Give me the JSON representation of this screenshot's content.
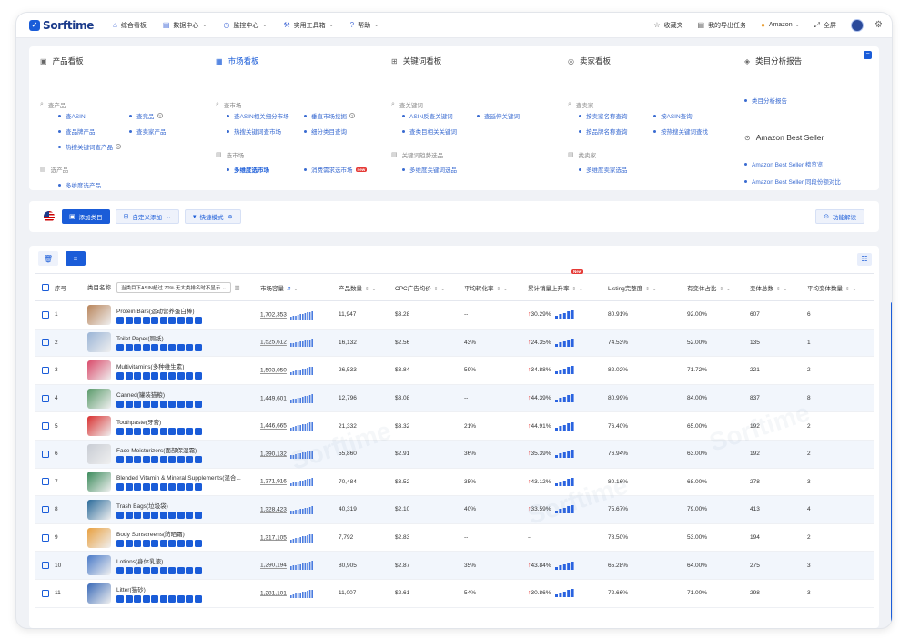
{
  "topbar": {
    "logo": "Sorftime",
    "nav": [
      {
        "icon": "home-icon",
        "label": "综合看板",
        "dropdown": false
      },
      {
        "icon": "database-icon",
        "label": "数据中心",
        "dropdown": true
      },
      {
        "icon": "monitor-icon",
        "label": "监控中心",
        "dropdown": true
      },
      {
        "icon": "toolbox-icon",
        "label": "实用工具箱",
        "dropdown": true
      },
      {
        "icon": "help-icon",
        "label": "帮助",
        "dropdown": true
      }
    ],
    "right": {
      "favorites": "收藏夹",
      "export_tasks": "我的导出任务",
      "marketplace": "Amazon",
      "fullscreen": "全屏"
    }
  },
  "menu": {
    "product": {
      "title": "产品看板",
      "sec1": "查产品",
      "links1": [
        "查ASIN",
        "查竞品",
        "查品牌产品",
        "查卖家产品",
        "热搜关键词查产品"
      ],
      "sec2": "选产品",
      "links2": [
        "多维度选产品"
      ]
    },
    "market": {
      "title": "市场看板",
      "sec1": "查市场",
      "links1": [
        "查ASIN相关细分市场",
        "垂直市场挖掘",
        "热搜关键词查市场",
        "细分类目查询"
      ],
      "sec2": "选市场",
      "links2": [
        "多维度选市场",
        "消费需求选市场"
      ],
      "new_label": "new"
    },
    "keyword": {
      "title": "关键词看板",
      "sec1": "查关键词",
      "links1": [
        "ASIN反查关键词",
        "查延伸关键词",
        "查类目相关关键词"
      ],
      "sec2": "关键词趋势选品",
      "links2": [
        "多维度关键词选品"
      ]
    },
    "seller": {
      "title": "卖家看板",
      "sec1": "查卖家",
      "links1": [
        "按卖家名称查询",
        "按ASIN查询",
        "按品牌名称查询",
        "按热搜关键词查找"
      ],
      "sec2": "找卖家",
      "links2": [
        "多维度卖家选品"
      ]
    },
    "category": {
      "title": "类目分析报告",
      "links1": [
        "类目分析报告"
      ],
      "title2": "Amazon Best Seller",
      "links2": [
        "Amazon Best Seller 榜览览",
        "Amazon Best Seller 同段份额对比"
      ]
    }
  },
  "toolbar": {
    "add_category": "添加类目",
    "custom_add": "自定义添加",
    "quick_mode": "快捷模式",
    "explain": "功能解读"
  },
  "table": {
    "filter_label": "当类目下ASIN超过 70% 无大类排名时不显示",
    "headers": {
      "checkbox": "",
      "index": "序号",
      "name": "类目名称",
      "market_cap": "市场容量",
      "product_count": "产品数量",
      "cpc": "CPC广告均价",
      "conversion": "平均转化率",
      "sales_rise": "累计销量上升率",
      "listing": "Listing完整度",
      "variant_ratio": "有变体占比",
      "variant_total": "变体总数",
      "avg_variant": "平均变体数量"
    },
    "new_tag": "New",
    "rows": [
      {
        "idx": "1",
        "name": "Protein Bars(运动营养蛋白棒)",
        "color": "#b8845a",
        "mc": "1,702,353",
        "pc": "11,947",
        "cpc": "$3.28",
        "conv": "--",
        "rise": "30.29%",
        "list": "80.91%",
        "vr": "92.00%",
        "vt": "607",
        "av": "6"
      },
      {
        "idx": "2",
        "name": "Toilet Paper(厕纸)",
        "color": "#9ab4d6",
        "mc": "1,525,612",
        "pc": "16,132",
        "cpc": "$2.56",
        "conv": "43%",
        "rise": "24.35%",
        "list": "74.53%",
        "vr": "52.00%",
        "vt": "135",
        "av": "1"
      },
      {
        "idx": "3",
        "name": "Multivitamins(多种维生素)",
        "color": "#d94a6a",
        "mc": "1,503,050",
        "pc": "26,533",
        "cpc": "$3.84",
        "conv": "59%",
        "rise": "34.88%",
        "list": "82.02%",
        "vr": "71.72%",
        "vt": "221",
        "av": "2"
      },
      {
        "idx": "4",
        "name": "Canned(罐装猫粮)",
        "color": "#5a9a6a",
        "mc": "1,449,601",
        "pc": "12,796",
        "cpc": "$3.08",
        "conv": "--",
        "rise": "44.39%",
        "list": "80.99%",
        "vr": "84.00%",
        "vt": "837",
        "av": "8"
      },
      {
        "idx": "5",
        "name": "Toothpaste(牙膏)",
        "color": "#d83030",
        "mc": "1,446,665",
        "pc": "21,332",
        "cpc": "$3.32",
        "conv": "21%",
        "rise": "44.91%",
        "list": "76.40%",
        "vr": "65.00%",
        "vt": "192",
        "av": "2"
      },
      {
        "idx": "6",
        "name": "Face Moisturizers(面部保湿霜)",
        "color": "#c8ccd4",
        "mc": "1,390,132",
        "pc": "55,860",
        "cpc": "$2.91",
        "conv": "36%",
        "rise": "35.39%",
        "list": "76.94%",
        "vr": "63.00%",
        "vt": "192",
        "av": "2"
      },
      {
        "idx": "7",
        "name": "Blended Vitamin & Mineral Supplements(混合...",
        "color": "#3a8a5a",
        "mc": "1,371,916",
        "pc": "70,484",
        "cpc": "$3.52",
        "conv": "35%",
        "rise": "43.12%",
        "list": "80.16%",
        "vr": "68.00%",
        "vt": "278",
        "av": "3"
      },
      {
        "idx": "8",
        "name": "Trash Bags(垃圾袋)",
        "color": "#2a6a9a",
        "mc": "1,328,423",
        "pc": "40,319",
        "cpc": "$2.10",
        "conv": "40%",
        "rise": "33.59%",
        "list": "75.67%",
        "vr": "79.00%",
        "vt": "413",
        "av": "4"
      },
      {
        "idx": "9",
        "name": "Body Sunscreens(防晒霜)",
        "color": "#e8a040",
        "mc": "1,317,105",
        "pc": "7,792",
        "cpc": "$2.83",
        "conv": "--",
        "rise": "--",
        "list": "78.50%",
        "vr": "53.00%",
        "vt": "194",
        "av": "2"
      },
      {
        "idx": "10",
        "name": "Lotions(身体乳液)",
        "color": "#4a7ac8",
        "mc": "1,290,194",
        "pc": "80,905",
        "cpc": "$2.87",
        "conv": "35%",
        "rise": "43.84%",
        "list": "65.28%",
        "vr": "64.00%",
        "vt": "275",
        "av": "3"
      },
      {
        "idx": "11",
        "name": "Litter(猫砂)",
        "color": "#3a6ab8",
        "mc": "1,281,101",
        "pc": "11,007",
        "cpc": "$2.61",
        "conv": "54%",
        "rise": "30.86%",
        "list": "72.66%",
        "vr": "71.00%",
        "vt": "298",
        "av": "3"
      }
    ]
  }
}
